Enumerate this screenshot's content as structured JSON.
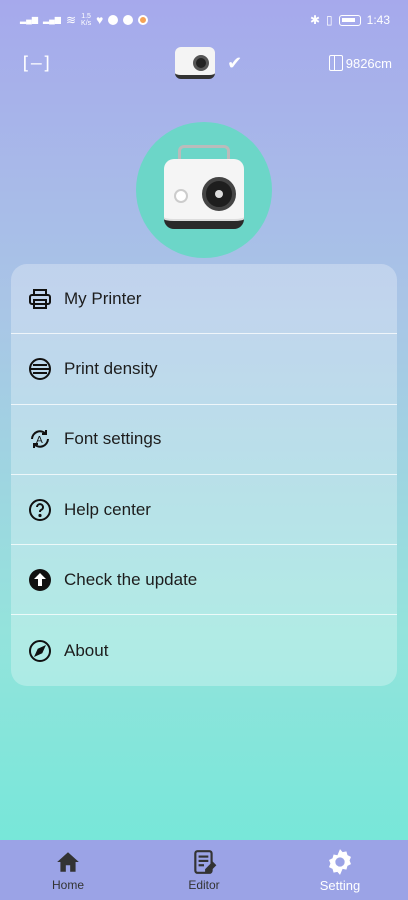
{
  "status_bar": {
    "net_speed_value": "1.5",
    "net_speed_unit": "K/s",
    "time": "1:43"
  },
  "top_bar": {
    "paper_length": "9826cm"
  },
  "menu": {
    "items": [
      {
        "label": "My Printer",
        "icon": "printer-icon"
      },
      {
        "label": "Print density",
        "icon": "density-icon"
      },
      {
        "label": "Font settings",
        "icon": "font-settings-icon"
      },
      {
        "label": "Help center",
        "icon": "help-icon"
      },
      {
        "label": "Check the update",
        "icon": "update-icon"
      },
      {
        "label": "About",
        "icon": "about-icon"
      }
    ]
  },
  "bottom_nav": {
    "items": [
      {
        "label": "Home",
        "icon": "home-icon",
        "active": false
      },
      {
        "label": "Editor",
        "icon": "editor-icon",
        "active": false
      },
      {
        "label": "Setting",
        "icon": "gear-icon",
        "active": true
      }
    ]
  },
  "colors": {
    "gradient_top": "#a6a9ec",
    "gradient_bottom": "#6fe8d8",
    "hero_circle": "#6cd6c8",
    "nav_bar": "#9ba3e6",
    "active_nav": "#ffffff"
  }
}
